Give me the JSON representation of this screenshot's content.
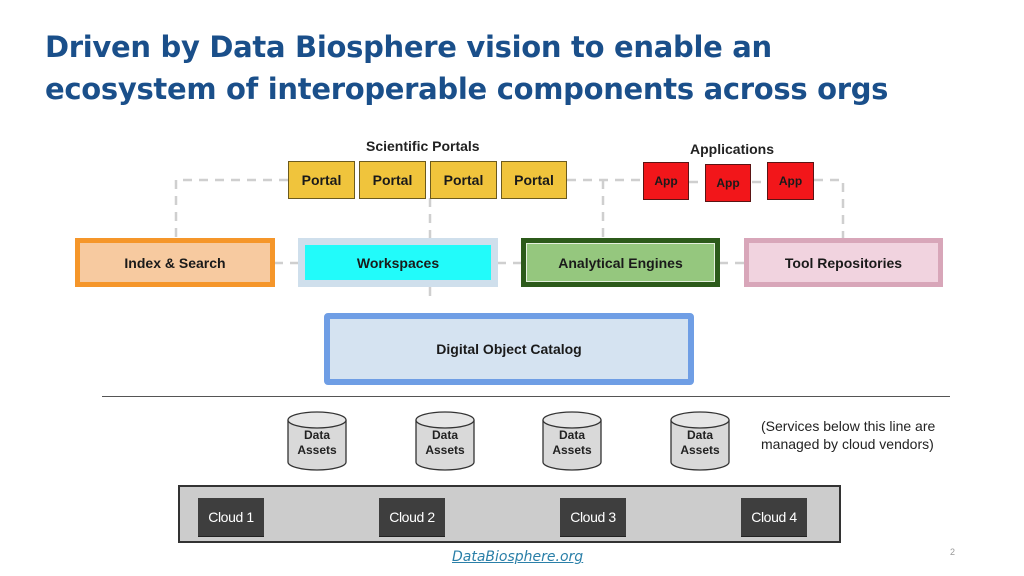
{
  "slide": {
    "title_lines": [
      "Driven by Data Biosphere vision to enable an",
      "ecosystem of interoperable components across orgs"
    ],
    "page_number": "2",
    "footer_link": "DataBiosphere.org"
  },
  "diagram": {
    "scientific_portals": {
      "label": "Scientific Portals",
      "items": [
        "Portal",
        "Portal",
        "Portal",
        "Portal"
      ]
    },
    "applications": {
      "label": "Applications",
      "items": [
        "App",
        "App",
        "App"
      ]
    },
    "components": [
      {
        "label": "Index & Search",
        "color": "#f7caa0",
        "border": "#f5962a"
      },
      {
        "label": "Workspaces",
        "color": "#22fbfa",
        "border": "#cfdfec"
      },
      {
        "label": "Analytical Engines",
        "color": "#95c77e",
        "border": "#2c5a1a"
      },
      {
        "label": "Tool Repositories",
        "color": "#f1d3df",
        "border": "#d8a6b9"
      }
    ],
    "catalog": {
      "label": "Digital Object Catalog"
    },
    "data_assets": [
      {
        "line1": "Data",
        "line2": "Assets"
      },
      {
        "line1": "Data",
        "line2": "Assets"
      },
      {
        "line1": "Data",
        "line2": "Assets"
      },
      {
        "line1": "Data",
        "line2": "Assets"
      }
    ],
    "note_lines": [
      "(Services below this line are",
      "managed by cloud vendors)"
    ],
    "clouds": [
      "Cloud 1",
      "Cloud 2",
      "Cloud 3",
      "Cloud 4"
    ]
  }
}
